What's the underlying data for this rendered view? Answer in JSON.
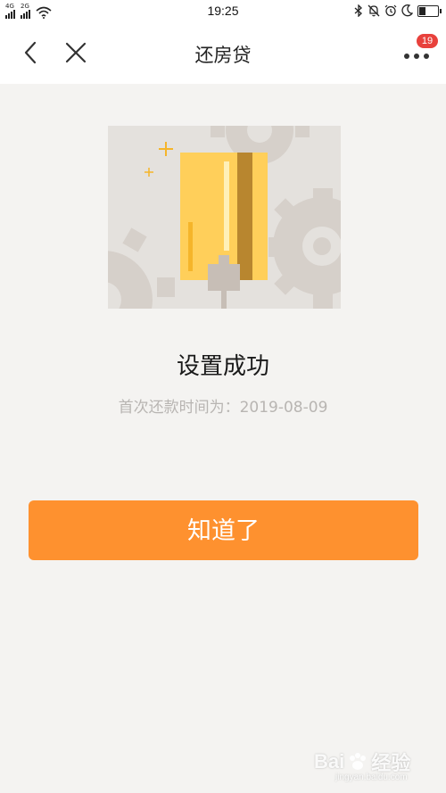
{
  "status_bar": {
    "network_1": "4G",
    "network_2": "2G",
    "time": "19:25",
    "icons": [
      "signal-icon",
      "signal-icon",
      "wifi-icon",
      "bluetooth-icon",
      "mute-icon",
      "alarm-icon",
      "moon-icon",
      "battery-icon"
    ],
    "battery_level": 0.3
  },
  "nav": {
    "title": "还房贷",
    "back_icon": "chevron-left-icon",
    "close_icon": "close-icon",
    "more_icon": "more-dots-icon",
    "badge_count": "19"
  },
  "main": {
    "illustration_icon": "card-gear-illustration",
    "success_title": "设置成功",
    "first_repay_text": "首次还款时间为：2019-08-09"
  },
  "actions": {
    "confirm_label": "知道了"
  },
  "watermark": {
    "brand": "Bai",
    "suffix": "经验",
    "url": "jingyan.baidu.com"
  },
  "colors": {
    "accent": "#fe912f",
    "badge": "#e8413c",
    "background": "#f4f3f1",
    "card": "#ffcf5a"
  }
}
